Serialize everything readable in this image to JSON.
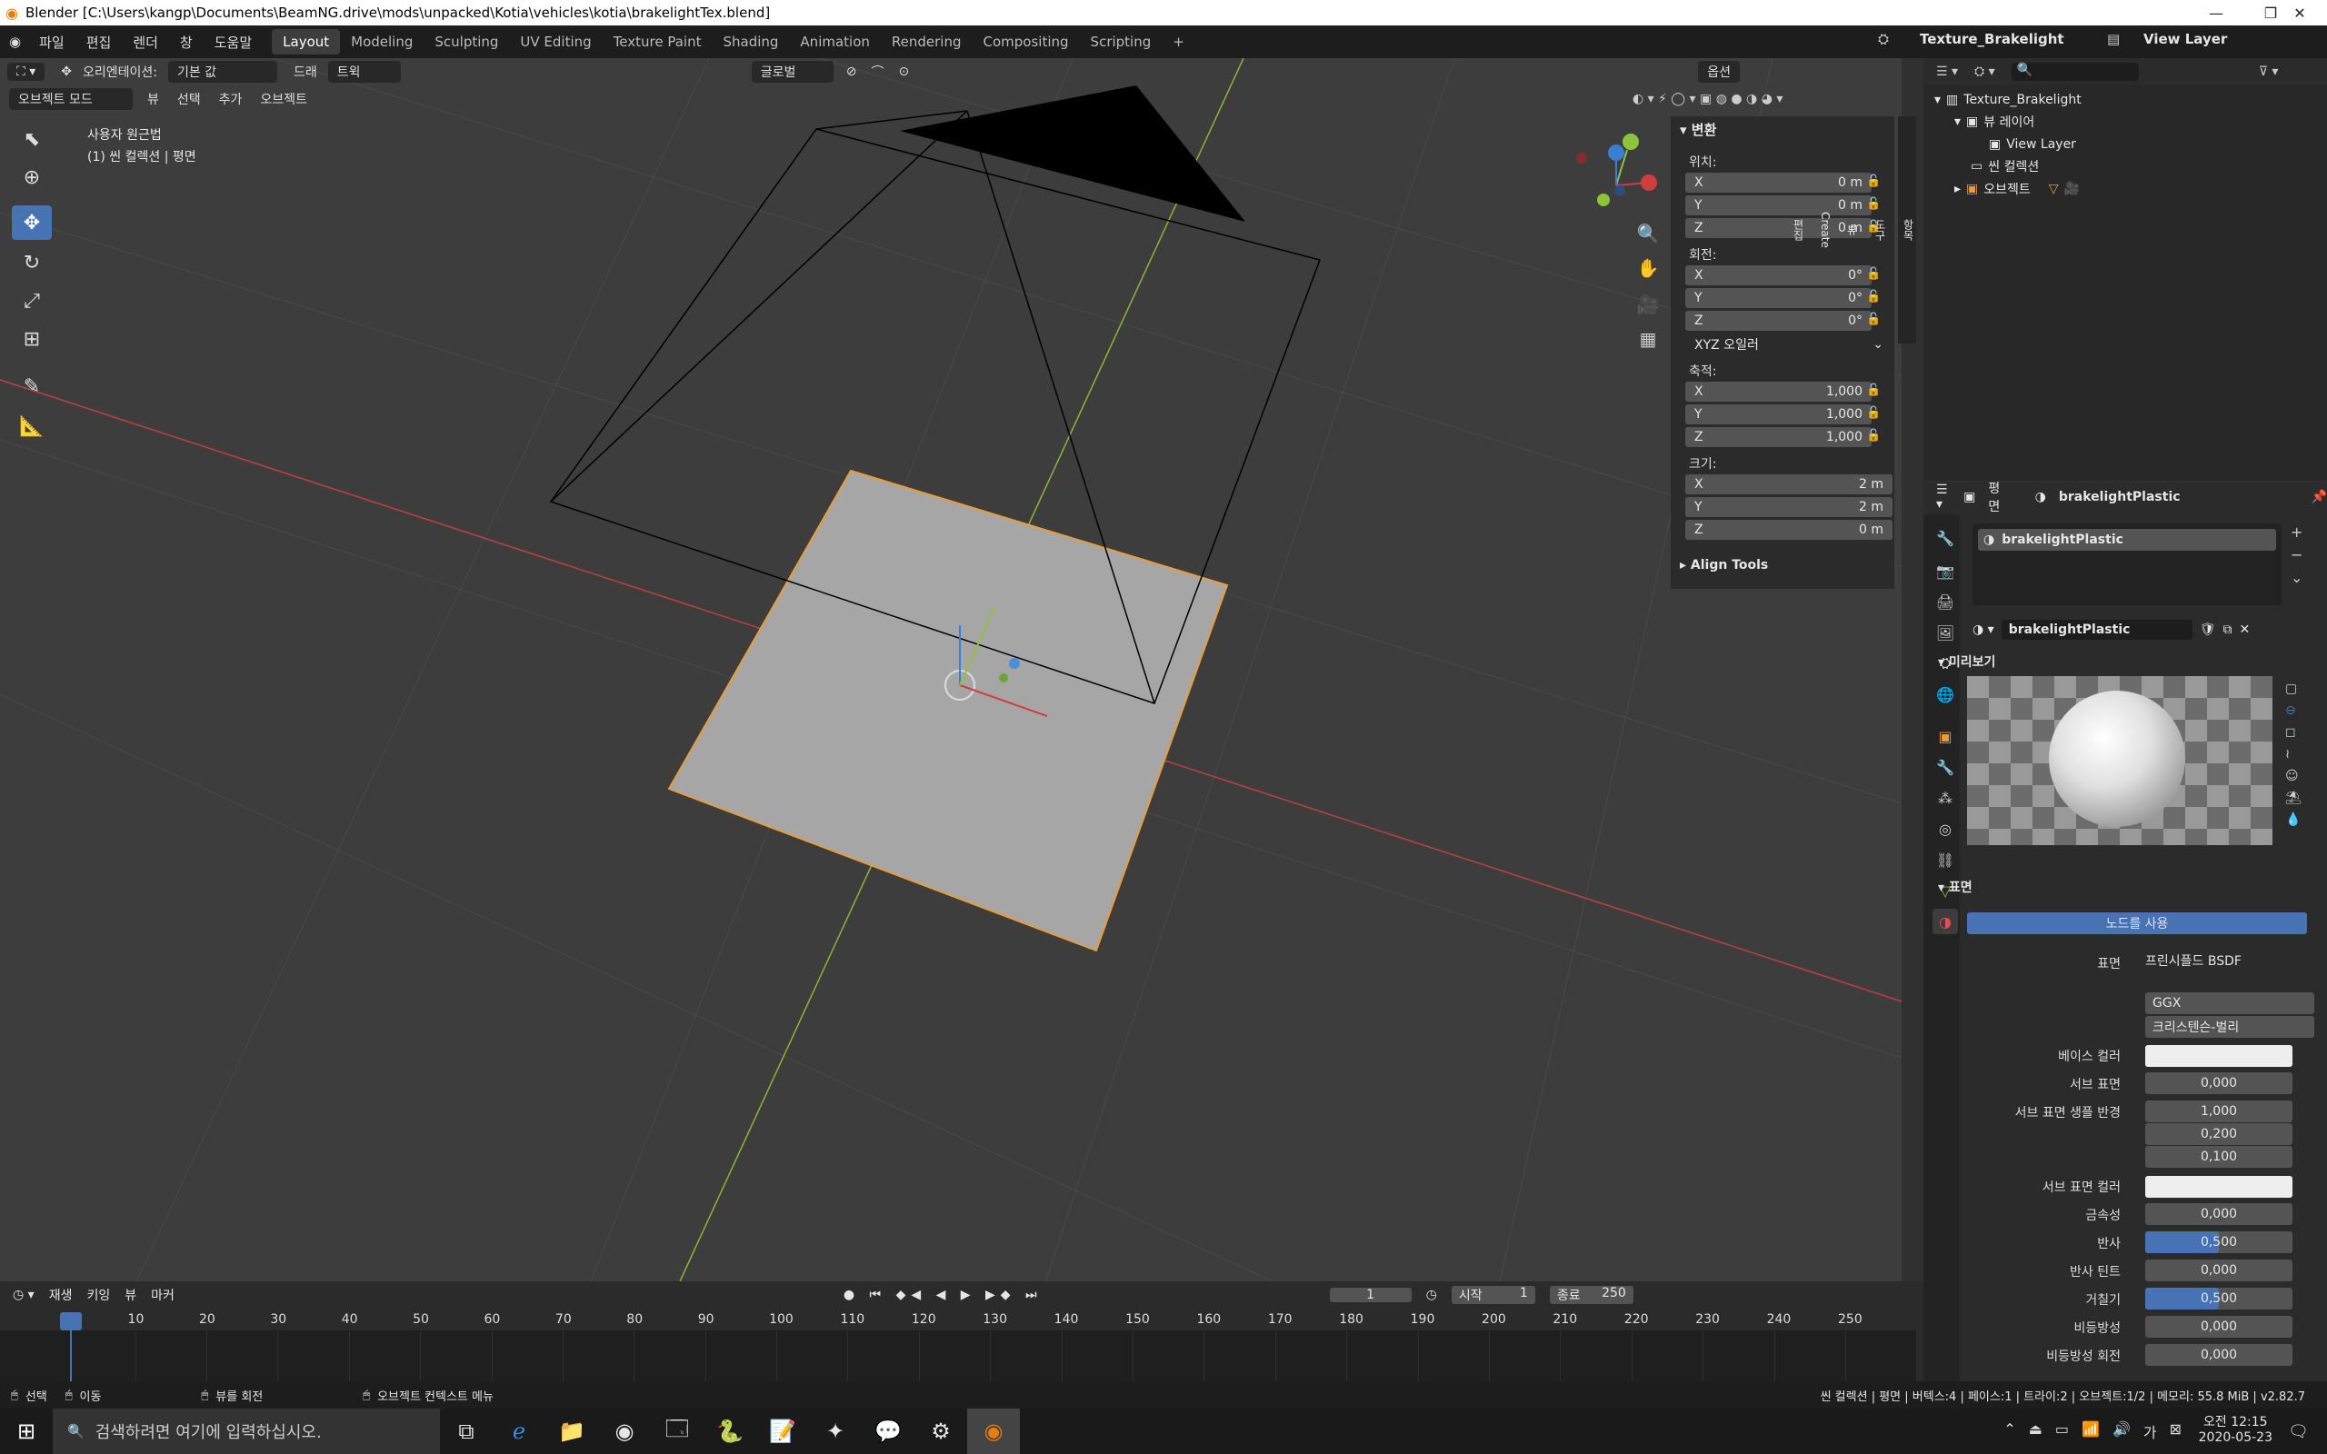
{
  "window": {
    "title": "Blender [C:\\Users\\kangp\\Documents\\BeamNG.drive\\mods\\unpacked\\Kotia\\vehicles\\kotia\\brakelightTex.blend]"
  },
  "menus": [
    "파일",
    "편집",
    "렌더",
    "창",
    "도움말"
  ],
  "workspaces": [
    "Layout",
    "Modeling",
    "Sculpting",
    "UV Editing",
    "Texture Paint",
    "Shading",
    "Animation",
    "Rendering",
    "Compositing",
    "Scripting"
  ],
  "top_right": {
    "scene": "Texture_Brakelight",
    "view_layer": "View Layer"
  },
  "viewport_header": {
    "orientation_label": "오리엔테이션:",
    "orientation_value": "기본 값",
    "drag_label": "드래",
    "drag_value": "트윅",
    "transform_space": "글로벌",
    "options": "옵션",
    "mode": "오브젝트 모드",
    "view": "뷰",
    "select": "선택",
    "add": "추가",
    "object": "오브젝트"
  },
  "viewport_info": {
    "projection": "사용자 원근법",
    "collection": "(1) 씬 컬렉션 | 평면"
  },
  "npanel": {
    "transform_header": "변환",
    "location_label": "위치:",
    "location": {
      "x": "0 m",
      "y": "0 m",
      "z": "0 m"
    },
    "rotation_label": "회전:",
    "rotation": {
      "x": "0°",
      "y": "0°",
      "z": "0°"
    },
    "rotation_mode": "XYZ 오일러",
    "scale_label": "축적:",
    "scale": {
      "x": "1,000",
      "y": "1,000",
      "z": "1,000"
    },
    "dimensions_label": "크기:",
    "dimensions": {
      "x": "2 m",
      "y": "2 m",
      "z": "0 m"
    },
    "align_tools": "Align Tools",
    "axis_labels": {
      "x": "X",
      "y": "Y",
      "z": "Z"
    },
    "side_tabs": [
      "항목",
      "도구",
      "뷰",
      "Create",
      "편집"
    ]
  },
  "outliner": {
    "scene": "Texture_Brakelight",
    "view_layer_group": "뷰 레이어",
    "view_layer": "View Layer",
    "scene_collection": "씬 컬렉션",
    "objects": "오브젝트"
  },
  "properties": {
    "object_name": "평면",
    "material_name": "brakelightPlastic",
    "slot_name": "brakelightPlastic",
    "datablock_name": "brakelightPlastic",
    "preview_header": "미리보기",
    "surface_header": "표면",
    "use_nodes": "노드를 사용",
    "surface_label": "표면",
    "surface_value": "프린시플드 BSDF",
    "distribution": "GGX",
    "subsurface_method": "크리스텐슨-벌리",
    "fields": [
      {
        "label": "베이스 컬러",
        "value": "",
        "type": "color"
      },
      {
        "label": "서브 표면",
        "value": "0,000",
        "type": "num"
      },
      {
        "label": "서브 표면 생플 반경",
        "value": "1,000",
        "type": "num"
      },
      {
        "label": "",
        "value": "0,200",
        "type": "num"
      },
      {
        "label": "",
        "value": "0,100",
        "type": "num"
      },
      {
        "label": "서브 표면 컬러",
        "value": "",
        "type": "color"
      },
      {
        "label": "금속성",
        "value": "0,000",
        "type": "num"
      },
      {
        "label": "반사",
        "value": "0,500",
        "type": "slider",
        "fill": 0.5
      },
      {
        "label": "반사 틴트",
        "value": "0,000",
        "type": "num"
      },
      {
        "label": "거칠기",
        "value": "0,500",
        "type": "slider",
        "fill": 0.5
      },
      {
        "label": "비등방성",
        "value": "0,000",
        "type": "num"
      },
      {
        "label": "비등방성 회전",
        "value": "0,000",
        "type": "num"
      }
    ]
  },
  "timeline": {
    "menu": [
      "재생",
      "키잉",
      "뷰",
      "마커"
    ],
    "current_frame": "1",
    "start_label": "시작",
    "start": "1",
    "end_label": "종료",
    "end": "250",
    "ticks": [
      "1",
      "10",
      "20",
      "30",
      "40",
      "50",
      "60",
      "70",
      "80",
      "90",
      "100",
      "110",
      "120",
      "130",
      "140",
      "150",
      "160",
      "170",
      "180",
      "190",
      "200",
      "210",
      "220",
      "230",
      "240",
      "250"
    ]
  },
  "statusbar": {
    "left": [
      "선택",
      "이동",
      "뷰를 회전",
      "오브젝트 컨텍스트 메뉴"
    ],
    "right": "씬 컬렉션 | 평면 | 버텍스:4 | 페이스:1 | 트라이:2 | 오브젝트:1/2 | 메모리: 55.8 MiB | v2.82.7"
  },
  "taskbar": {
    "search_placeholder": "검색하려면 여기에 입력하십시오.",
    "time": "오전 12:15",
    "date": "2020-05-23"
  },
  "colors": {
    "accent": "#4772b3",
    "selection_outline": "#e89c3a",
    "x_axis": "#c04040",
    "y_axis": "#8fb336"
  }
}
